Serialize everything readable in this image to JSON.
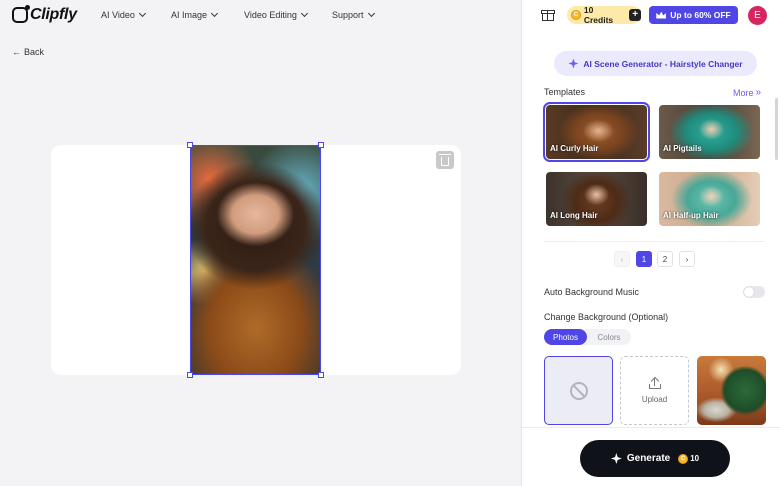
{
  "header": {
    "logo": "Clipfly",
    "nav": [
      {
        "label": "AI Video"
      },
      {
        "label": "AI Image"
      },
      {
        "label": "Video Editing"
      },
      {
        "label": "Support"
      }
    ]
  },
  "back_label": "Back",
  "account": {
    "credits_label": "10 Credits",
    "offer_label": "Up to 60% OFF",
    "avatar_initial": "E"
  },
  "tool": {
    "title": "AI Scene Generator - Hairstyle Changer"
  },
  "templates": {
    "label": "Templates",
    "more_label": "More",
    "items": [
      {
        "label": "AI Curly Hair",
        "selected": true
      },
      {
        "label": "AI Pigtails",
        "selected": false
      },
      {
        "label": "AI Long Hair",
        "selected": false
      },
      {
        "label": "AI Half-up Hair",
        "selected": false
      }
    ],
    "pagination": {
      "prev": "‹",
      "pages": [
        "1",
        "2"
      ],
      "current": "1",
      "next": "›"
    }
  },
  "auto_music": {
    "label": "Auto Background Music",
    "enabled": false
  },
  "background": {
    "label": "Change Background (Optional)",
    "tabs": [
      "Photos",
      "Colors"
    ],
    "active_tab": "Photos",
    "upload_label": "Upload"
  },
  "generate": {
    "label": "Generate",
    "cost": "10"
  },
  "colors": {
    "accent": "#4f46e5",
    "selection": "#4c47e8",
    "avatar": "#d6255f",
    "credits_bg": "#fde9a8",
    "generate_bg": "#10121a"
  }
}
